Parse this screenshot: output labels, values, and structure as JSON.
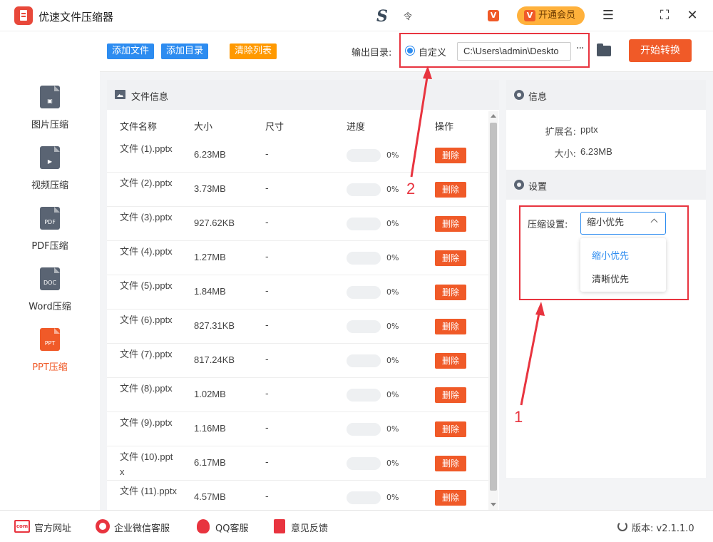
{
  "app": {
    "title": "优速文件压缩器",
    "brand_letter": "S",
    "brand_sub": "令",
    "vip_badge_letter": "V",
    "vip_button_label": "开通会员"
  },
  "window_controls": {
    "menu": "☰",
    "maximize": "⛶",
    "close": "✕"
  },
  "sidebar": {
    "items": [
      {
        "label": "图片压缩",
        "icon_text": "▣",
        "icon": "image-file-icon",
        "active": false
      },
      {
        "label": "视频压缩",
        "icon_text": "▶",
        "icon": "video-file-icon",
        "active": false
      },
      {
        "label": "PDF压缩",
        "icon_text": "PDF",
        "icon": "pdf-file-icon",
        "active": false
      },
      {
        "label": "Word压缩",
        "icon_text": "DOC",
        "icon": "doc-file-icon",
        "active": false
      },
      {
        "label": "PPT压缩",
        "icon_text": "PPT",
        "icon": "ppt-file-icon",
        "active": true
      }
    ]
  },
  "toolbar": {
    "add_file": "添加文件",
    "add_folder": "添加目录",
    "clear_list": "清除列表",
    "output_label": "输出目录:",
    "radio_label": "自定义",
    "output_path": "C:\\Users\\admin\\Deskto",
    "more": "···",
    "start": "开始转换"
  },
  "file_panel": {
    "title": "文件信息",
    "columns": [
      "文件名称",
      "大小",
      "尺寸",
      "进度",
      "操作"
    ],
    "rows": [
      {
        "name": "文件 (1).pptx",
        "size": "6.23MB",
        "dim": "-",
        "progress": "0%",
        "progress_value": 0,
        "action": "删除"
      },
      {
        "name": "文件 (2).pptx",
        "size": "3.73MB",
        "dim": "-",
        "progress": "0%",
        "progress_value": 0,
        "action": "删除"
      },
      {
        "name": "文件 (3).pptx",
        "size": "927.62KB",
        "dim": "-",
        "progress": "0%",
        "progress_value": 0,
        "action": "删除"
      },
      {
        "name": "文件 (4).pptx",
        "size": "1.27MB",
        "dim": "-",
        "progress": "0%",
        "progress_value": 0,
        "action": "删除"
      },
      {
        "name": "文件 (5).pptx",
        "size": "1.84MB",
        "dim": "-",
        "progress": "0%",
        "progress_value": 0,
        "action": "删除"
      },
      {
        "name": "文件 (6).pptx",
        "size": "827.31KB",
        "dim": "-",
        "progress": "0%",
        "progress_value": 0,
        "action": "删除"
      },
      {
        "name": "文件 (7).pptx",
        "size": "817.24KB",
        "dim": "-",
        "progress": "0%",
        "progress_value": 0,
        "action": "删除"
      },
      {
        "name": "文件 (8).pptx",
        "size": "1.02MB",
        "dim": "-",
        "progress": "0%",
        "progress_value": 0,
        "action": "删除"
      },
      {
        "name": "文件 (9).pptx",
        "size": "1.16MB",
        "dim": "-",
        "progress": "0%",
        "progress_value": 0,
        "action": "删除"
      },
      {
        "name": "文件 (10).pptx",
        "size": "6.17MB",
        "dim": "-",
        "progress": "0%",
        "progress_value": 0,
        "action": "删除"
      },
      {
        "name": "文件 (11).pptx",
        "size": "4.57MB",
        "dim": "-",
        "progress": "0%",
        "progress_value": 0,
        "action": "删除"
      }
    ]
  },
  "info_panel": {
    "title": "信息",
    "ext_label": "扩展名:",
    "ext_value": "pptx",
    "size_label": "大小:",
    "size_value": "6.23MB"
  },
  "settings_panel": {
    "title": "设置",
    "compress_label": "压缩设置:",
    "selected": "缩小优先",
    "options": [
      "缩小优先",
      "清晰优先"
    ]
  },
  "annotations": {
    "one": "1",
    "two": "2"
  },
  "footer": {
    "website": "官方网址",
    "website_icon_text": "com",
    "wechat": "企业微信客服",
    "qq": "QQ客服",
    "feedback": "意见反馈",
    "version": "版本: v2.1.1.0"
  },
  "colors": {
    "accent_orange": "#f05a28",
    "accent_blue": "#2d8cf0",
    "clear_orange": "#ff9900",
    "annotation_red": "#e8343f"
  }
}
